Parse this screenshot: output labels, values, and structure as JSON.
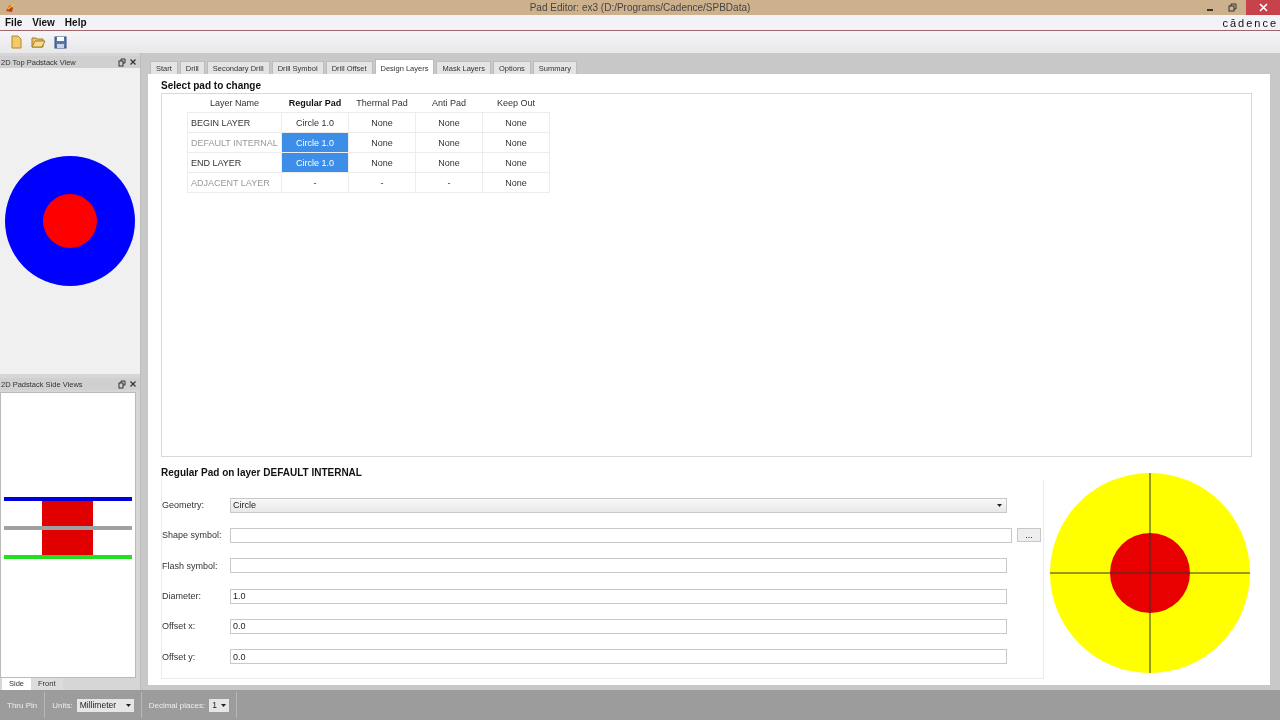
{
  "window": {
    "title": "Pad Editor: ex3  (D:/Programs/Cadence/SPBData)",
    "logo": "cādence"
  },
  "menu": [
    "File",
    "View",
    "Help"
  ],
  "docks": [
    {
      "title": "2D Top Padstack View",
      "kind": "top"
    },
    {
      "title": "2D Padstack Side Views",
      "kind": "side",
      "tabs": [
        {
          "label": "Side",
          "selected": true
        },
        {
          "label": "Front",
          "selected": false
        }
      ]
    }
  ],
  "tabs": [
    {
      "label": "Start",
      "selected": false
    },
    {
      "label": "Drill",
      "selected": false
    },
    {
      "label": "Secondary Drill",
      "selected": false
    },
    {
      "label": "Drill Symbol",
      "selected": false
    },
    {
      "label": "Drill Offset",
      "selected": false
    },
    {
      "label": "Design Layers",
      "selected": true
    },
    {
      "label": "Mask Layers",
      "selected": false
    },
    {
      "label": "Options",
      "selected": false
    },
    {
      "label": "Summary",
      "selected": false
    }
  ],
  "layers": {
    "title": "Select pad to change",
    "columns": [
      {
        "label": "Layer Name",
        "selected": false
      },
      {
        "label": "Regular Pad",
        "selected": true
      },
      {
        "label": "Thermal Pad",
        "selected": false
      },
      {
        "label": "Anti Pad",
        "selected": false
      },
      {
        "label": "Keep Out",
        "selected": false
      }
    ],
    "rows": [
      {
        "cells": [
          {
            "text": "BEGIN LAYER",
            "disabled": false
          },
          {
            "text": "Circle 1.0",
            "selected": false
          },
          {
            "text": "None",
            "selected": false
          },
          {
            "text": "None",
            "selected": false
          },
          {
            "text": "None",
            "selected": false
          }
        ]
      },
      {
        "cells": [
          {
            "text": "DEFAULT INTERNAL",
            "disabled": true
          },
          {
            "text": "Circle 1.0",
            "selected": true
          },
          {
            "text": "None",
            "selected": false
          },
          {
            "text": "None",
            "selected": false
          },
          {
            "text": "None",
            "selected": false
          }
        ]
      },
      {
        "cells": [
          {
            "text": "END LAYER",
            "disabled": false
          },
          {
            "text": "Circle 1.0",
            "selected": true
          },
          {
            "text": "None",
            "selected": false
          },
          {
            "text": "None",
            "selected": false
          },
          {
            "text": "None",
            "selected": false
          }
        ]
      },
      {
        "cells": [
          {
            "text": "ADJACENT LAYER",
            "disabled": true
          },
          {
            "text": "-",
            "selected": false
          },
          {
            "text": "-",
            "selected": false
          },
          {
            "text": "-",
            "selected": false
          },
          {
            "text": "None",
            "selected": false
          }
        ]
      }
    ]
  },
  "pad": {
    "title": "Regular Pad on layer DEFAULT INTERNAL",
    "fields": [
      {
        "label": "Geometry:",
        "kind": "dropdown",
        "value": "Circle"
      },
      {
        "label": "Shape symbol:",
        "kind": "browse",
        "button": "..."
      },
      {
        "label": "Flash symbol:",
        "kind": "text"
      },
      {
        "label": "Diameter:",
        "kind": "text",
        "value": "1.0"
      },
      {
        "label": "Offset x:",
        "kind": "text",
        "value": "0.0"
      },
      {
        "label": "Offset y:",
        "kind": "text",
        "value": "0.0"
      }
    ]
  },
  "status_bar": {
    "mode": "Thru Pin",
    "units_label": "Units:",
    "units": "Millimeter",
    "decimals_label": "Decimal places:",
    "decimals": "1"
  }
}
